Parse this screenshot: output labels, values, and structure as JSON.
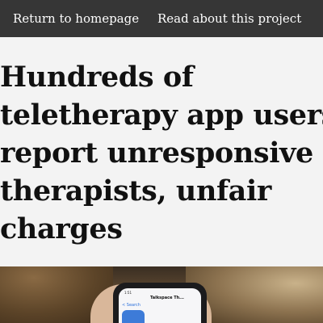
{
  "nav": {
    "home_label": "Return to homepage",
    "about_label": "Read about this project"
  },
  "article": {
    "headline_lines": [
      "Hundreds of",
      "teletherapy app users",
      "report unresponsive",
      "therapists, unfair",
      "charges"
    ]
  },
  "photo": {
    "back_label": "< Search",
    "app_name": "Talkspace Th...",
    "status_time": "1:51",
    "colors": {
      "phone": "#1b1b1d",
      "app_icon": "#3d7bd8"
    }
  },
  "colors": {
    "topbar": "#363636",
    "background": "#f3f3f3",
    "headline": "#111111"
  }
}
